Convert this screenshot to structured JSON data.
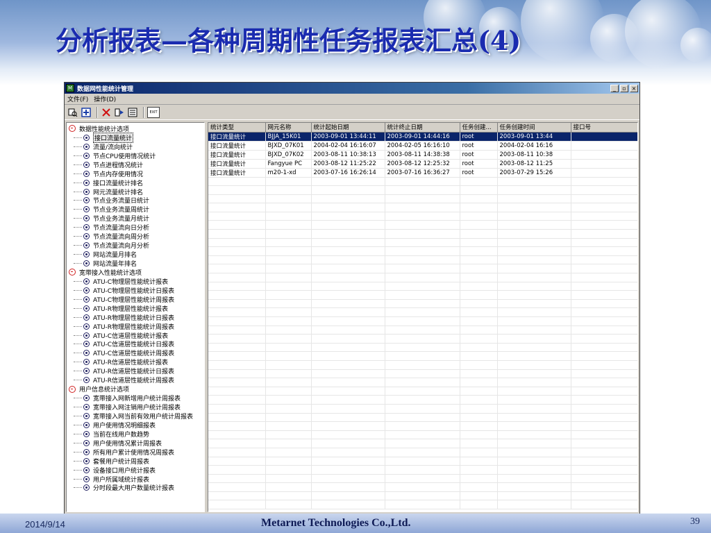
{
  "slide": {
    "title": "分析报表—各种周期性任务报表汇总(4)",
    "date": "2014/9/14",
    "company": "Metarnet Technologies Co.,Ltd.",
    "page_number": "39"
  },
  "window": {
    "title": "数据网性能统计管理",
    "icon_text": "M",
    "buttons": [
      "_",
      "▫",
      "×"
    ]
  },
  "menu": [
    "文件(F)",
    "操作(D)"
  ],
  "toolbar": {
    "icons": [
      "query-icon",
      "add-icon",
      "delete-icon",
      "export-icon",
      "list-icon"
    ],
    "exit_label": "EXIT"
  },
  "tree": [
    {
      "label": "数据性能统计选项",
      "children": [
        "接口流量统计",
        "流量/流向统计",
        "节点CPU使用情况统计",
        "节点进程情况统计",
        "节点内存使用情况",
        "接口流量统计排名",
        "网元流量统计排名",
        "节点业务流量日统计",
        "节点业务流量周统计",
        "节点业务流量月统计",
        "节点流量流向日分析",
        "节点流量流向周分析",
        "节点流量流向月分析",
        "网站流量月排名",
        "网站流量年排名"
      ]
    },
    {
      "label": "宽带接入性能统计选项",
      "children": [
        "ATU-C物理层性能统计报表",
        "ATU-C物理层性能统计日报表",
        "ATU-C物理层性能统计周报表",
        "ATU-R物理层性能统计报表",
        "ATU-R物理层性能统计日报表",
        "ATU-R物理层性能统计周报表",
        "ATU-C信道层性能统计报表",
        "ATU-C信道层性能统计日报表",
        "ATU-C信道层性能统计周报表",
        "ATU-R信道层性能统计报表",
        "ATU-R信道层性能统计日报表",
        "ATU-R信道层性能统计周报表"
      ]
    },
    {
      "label": "用户信息统计选项",
      "children": [
        "宽带接入网新增用户统计周报表",
        "宽带接入网注销用户统计周报表",
        "宽带接入网当前有效用户统计周报表",
        "用户使用情况明细报表",
        "当前在线用户数趋势",
        "用户使用情况累计周报表",
        "所有用户累计使用情况周报表",
        "套餐用户统计周报表",
        "设备接口用户统计报表",
        "用户所属域统计报表",
        "分时段最大用户数量统计报表"
      ]
    }
  ],
  "tree_selected": "接口流量统计",
  "table": {
    "columns": [
      "统计类型",
      "网元名称",
      "统计起始日期",
      "统计终止日期",
      "任务创建...",
      "任务创建时间",
      "接口号"
    ],
    "rows": [
      [
        "接口流量统计",
        "BJJA_15K01",
        "2003-09-01 13:44:11",
        "2003-09-01 14:44:16",
        "root",
        "2003-09-01 13:44",
        ""
      ],
      [
        "接口流量统计",
        "BJXD_07K01",
        "2004-02-04 16:16:07",
        "2004-02-05 16:16:10",
        "root",
        "2004-02-04 16:16",
        ""
      ],
      [
        "接口流量统计",
        "BJXD_07K02",
        "2003-08-11 10:38:13",
        "2003-08-11 14:38:38",
        "root",
        "2003-08-11 10:38",
        ""
      ],
      [
        "接口流量统计",
        "Fangyue PC",
        "2003-08-12 11:25:22",
        "2003-08-12 12:25:32",
        "root",
        "2003-08-12 11:25",
        ""
      ],
      [
        "接口流量统计",
        "m20-1-xd",
        "2003-07-16 16:26:14",
        "2003-07-16 16:36:27",
        "root",
        "2003-07-29 15:26",
        ""
      ]
    ],
    "selected_row": 0,
    "empty_rows": 38
  }
}
